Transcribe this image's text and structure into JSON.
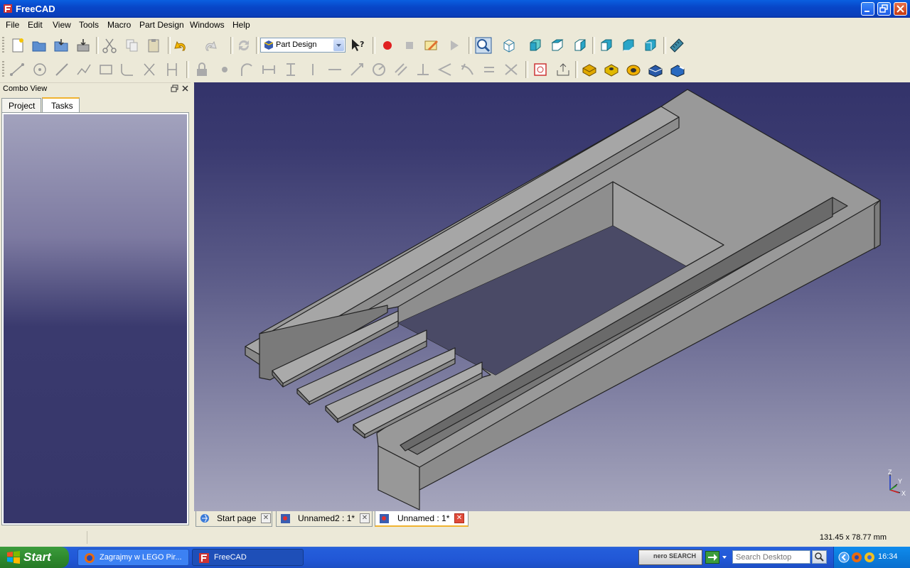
{
  "window": {
    "title": "FreeCAD"
  },
  "menu": [
    "File",
    "Edit",
    "View",
    "Tools",
    "Macro",
    "Part Design",
    "Windows",
    "Help"
  ],
  "toolbar1": {
    "icons": [
      "new-document-icon",
      "open-icon",
      "save-icon",
      "save-as-icon",
      "cut-icon",
      "copy-icon",
      "paste-icon",
      "undo-icon",
      "redo-icon",
      "refresh-icon"
    ],
    "view_icons": [
      "record-macro-icon",
      "stop-macro-icon",
      "edit-macro-icon",
      "play-macro-icon",
      "fit-all-icon",
      "axonometric-view-icon",
      "front-view-icon",
      "top-view-icon",
      "right-view-icon",
      "rear-view-icon",
      "bottom-view-icon",
      "left-view-icon",
      "measure-icon"
    ]
  },
  "workbench": {
    "selected": "Part Design"
  },
  "toolbar2": {
    "icons": [
      "sketch-line-icon",
      "sketch-circle-icon",
      "sketch-arc-icon",
      "sketch-polyline-icon",
      "sketch-rectangle-icon",
      "sketch-fillet-icon",
      "sketch-trim-icon",
      "sketch-external-icon",
      "lock-constraint-icon",
      "point-constraint-icon",
      "tangent-constraint-icon",
      "horizontal-distance-icon",
      "vertical-distance-icon",
      "vertical-constraint-icon",
      "horizontal-constraint-icon",
      "distance-constraint-icon",
      "radius-constraint-icon",
      "parallel-constraint-icon",
      "perpendicular-constraint-icon",
      "angle-constraint-icon",
      "tangent-curve-icon",
      "equal-constraint-icon",
      "symmetric-constraint-icon",
      "new-sketch-icon",
      "leave-sketch-icon",
      "pad-icon",
      "pocket-icon",
      "revolution-icon",
      "fillet-icon",
      "chamfer-icon"
    ]
  },
  "combo_view": {
    "title": "Combo View",
    "tabs": [
      {
        "label": "Project"
      },
      {
        "label": "Tasks"
      }
    ],
    "active_tab": "Tasks"
  },
  "document_tabs": [
    {
      "label": "Start page",
      "icon": "start-page-icon",
      "active": false
    },
    {
      "label": "Unnamed2 : 1*",
      "icon": "freecad-doc-icon",
      "active": false
    },
    {
      "label": "Unnamed : 1*",
      "icon": "freecad-doc-icon",
      "active": true
    }
  ],
  "axis": {
    "x": "X",
    "y": "Y",
    "z": "Z"
  },
  "status": {
    "dimensions": "131.45 x 78.77 mm"
  },
  "taskbar": {
    "start_label": "Start",
    "tasks": [
      {
        "label": "Zagrajmy w LEGO Pir..."
      },
      {
        "label": "FreeCAD"
      }
    ],
    "search_placeholder": "Search Desktop",
    "nero_label": "nero SEARCH",
    "clock": "16:34"
  },
  "colors": {
    "viewport_top": "#33336a",
    "viewport_bottom": "#a6a6bd",
    "model_face": "#9a9a9a",
    "model_edge": "#222222"
  }
}
